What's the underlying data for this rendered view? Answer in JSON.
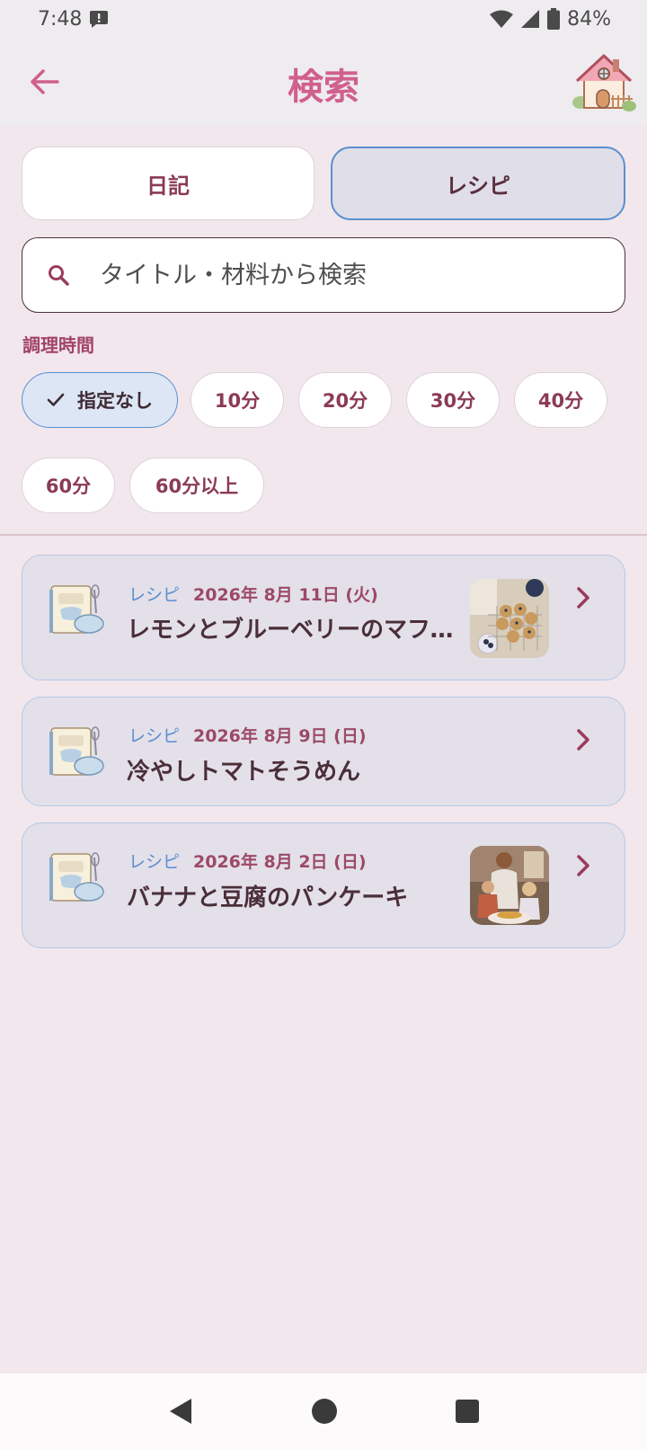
{
  "status_bar": {
    "time": "7:48",
    "battery": "84%",
    "icons": [
      "alert-message-icon",
      "wifi-icon",
      "signal-icon",
      "battery-icon"
    ]
  },
  "header": {
    "title": "検索",
    "back_icon": "arrow-left-icon",
    "home_icon": "house-icon"
  },
  "toggle": {
    "diary_label": "日記",
    "recipe_label": "レシピ",
    "selected": "recipe"
  },
  "search": {
    "placeholder": "タイトル・材料から検索",
    "value": ""
  },
  "filter": {
    "section_label": "調理時間",
    "chips": [
      {
        "label": "指定なし",
        "selected": true
      },
      {
        "label": "10分",
        "selected": false
      },
      {
        "label": "20分",
        "selected": false
      },
      {
        "label": "30分",
        "selected": false
      },
      {
        "label": "40分",
        "selected": false
      },
      {
        "label": "60分",
        "selected": false
      },
      {
        "label": "60分以上",
        "selected": false
      }
    ]
  },
  "results": [
    {
      "tag": "レシピ",
      "date": "2026年 8月 11日 (火)",
      "title": "レモンとブルーベリーのマフィン",
      "has_photo": true
    },
    {
      "tag": "レシピ",
      "date": "2026年 8月 9日 (日)",
      "title": "冷やしトマトそうめん",
      "has_photo": false
    },
    {
      "tag": "レシピ",
      "date": "2026年 8月 2日 (日)",
      "title": "バナナと豆腐のパンケーキ",
      "has_photo": true
    }
  ],
  "colors": {
    "accent": "#d0608e",
    "background": "#f2e7ec",
    "card_bg": "#e3e0ea",
    "selected_border": "#5b8fd0"
  },
  "nav": {
    "back_icon": "triangle-back-icon",
    "home_icon": "circle-home-icon",
    "recents_icon": "square-recents-icon"
  }
}
